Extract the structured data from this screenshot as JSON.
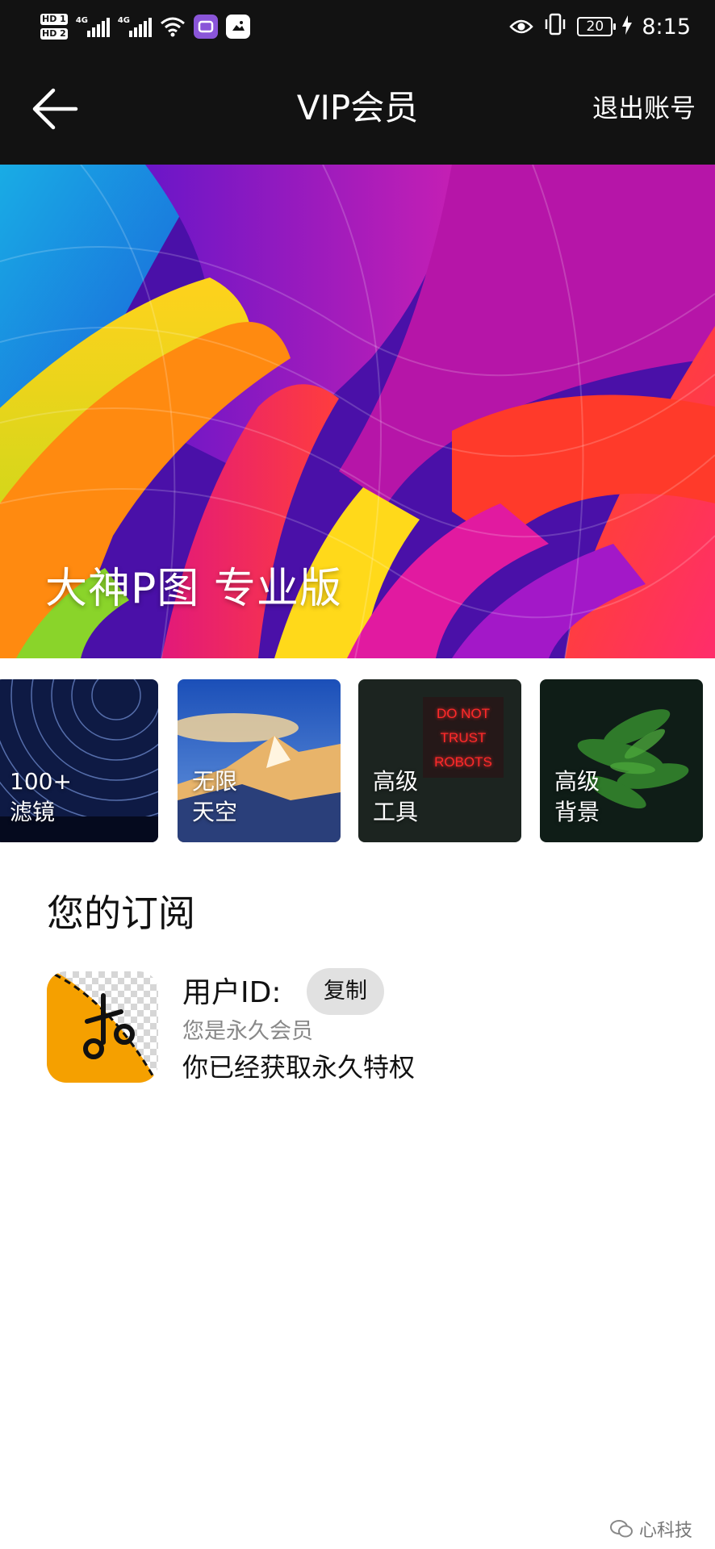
{
  "status_bar": {
    "hd1": "HD 1",
    "hd2": "HD 2",
    "sim1_label": "4G",
    "sim2_label": "4G",
    "battery": "20",
    "time": "8:15",
    "icons": [
      "signal-icon",
      "wifi-icon",
      "app-notification-icon",
      "eye-comfort-icon",
      "vibrate-icon",
      "battery-icon",
      "charging-icon"
    ]
  },
  "header": {
    "title": "VIP会员",
    "logout": "退出账号",
    "back_icon": "back-arrow-icon"
  },
  "hero": {
    "title": "大神P图 专业版"
  },
  "features": [
    {
      "line1": "100+",
      "line2": "滤镜"
    },
    {
      "line1": "无限",
      "line2": "天空"
    },
    {
      "line1": "高级",
      "line2": "工具",
      "sign_text": [
        "DO NOT",
        "TRUST",
        "ROBOTS"
      ]
    },
    {
      "line1": "高级",
      "line2": "背景"
    }
  ],
  "subscription": {
    "section_title": "您的订阅",
    "user_id_label": "用户ID:",
    "copy_button": "复制",
    "member_status": "您是永久会员",
    "privilege": "你已经获取永久特权",
    "app_icon": "scissors-icon",
    "accent_color": "#f5a000"
  },
  "watermark": {
    "text": "心科技"
  }
}
